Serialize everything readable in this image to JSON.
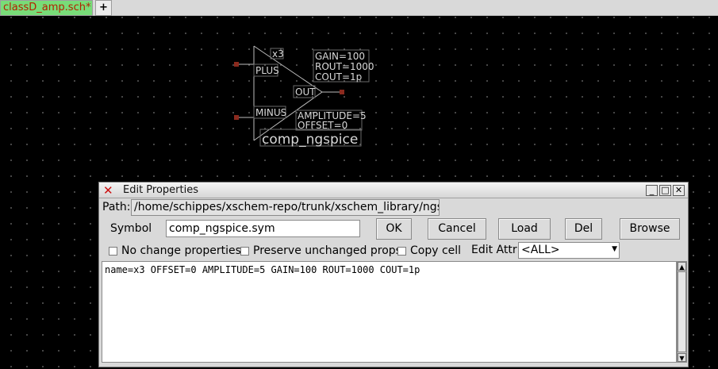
{
  "tabs": {
    "active": "classD_amp.sch*",
    "add": "+"
  },
  "symbol": {
    "instance_name": "x3",
    "pin_plus": "PLUS",
    "pin_minus": "MINUS",
    "pin_out": "OUT",
    "params_top": [
      "GAIN=100",
      "ROUT=1000",
      "COUT=1p"
    ],
    "params_bottom": [
      "AMPLITUDE=5",
      "OFFSET=0"
    ],
    "cell_name": "comp_ngspice"
  },
  "dialog": {
    "title": "Edit Properties",
    "path_label": "Path:",
    "path_value": "/home/schippes/xschem-repo/trunk/xschem_library/ngspice",
    "symbol_label": "Symbol",
    "symbol_value": "comp_ngspice.sym",
    "buttons": {
      "ok": "OK",
      "cancel": "Cancel",
      "load": "Load",
      "del": "Del",
      "browse": "Browse"
    },
    "checkboxes": {
      "no_change": "No change properties",
      "preserve": "Preserve unchanged props",
      "copy_cell": "Copy cell"
    },
    "edit_attr_label": "Edit Attr:",
    "edit_attr_value": "<ALL>",
    "text": "name=x3 OFFSET=0 AMPLITUDE=5 GAIN=100 ROUT=1000 COUT=1p"
  },
  "colors": {
    "canvas": "#000000",
    "tab_active_bg": "#78dc78",
    "tab_active_text": "#b32000",
    "pin": "#8b2a1e",
    "title_icon": "#cc1010"
  }
}
